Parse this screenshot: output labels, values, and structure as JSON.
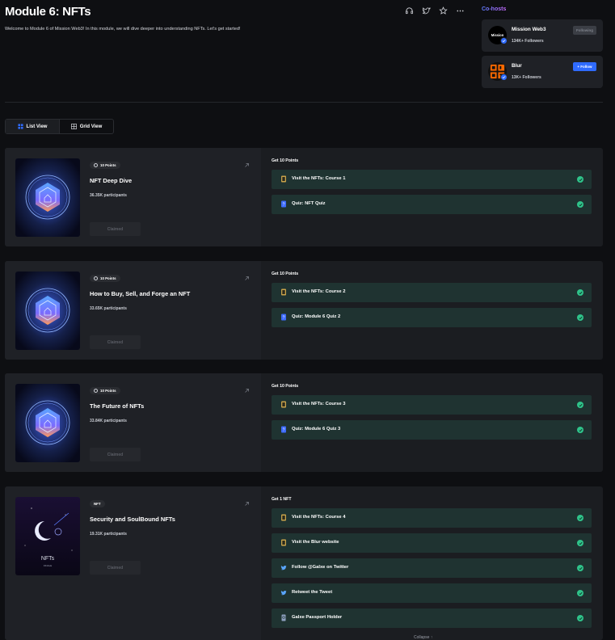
{
  "page": {
    "title": "Module 6: NFTs",
    "description": "Welcome to Module 6 of Mission Web3! In this module, we will dive deeper into understanding NFTs. Let's get started!"
  },
  "header_icons": [
    "headset-icon",
    "twitter-icon",
    "star-icon",
    "more-icon"
  ],
  "cohosts": {
    "title": "Co-hosts",
    "hosts": [
      {
        "name": "Mission Web3",
        "followers": "134K+ Followers",
        "button": "Following",
        "logo_text": "Mission"
      },
      {
        "name": "Blur",
        "followers": "13K+ Followers",
        "button": "+ Follow",
        "logo_text": "BLUR"
      }
    ]
  },
  "view_toggle": {
    "list": "List View",
    "grid": "Grid View",
    "selected": "List View"
  },
  "cards": [
    {
      "pill": "10 Points",
      "title": "NFT Deep Dive",
      "participants": "36.35K participants",
      "claim": "Claimed",
      "reward_header": "Get 10 Points",
      "tasks": [
        {
          "label": "Visit the NFTs: Course 1",
          "icon": "course-icon"
        },
        {
          "label": "Quiz: NFT Quiz",
          "icon": "quiz-icon"
        }
      ]
    },
    {
      "pill": "10 Points",
      "title": "How to Buy, Sell, and Forge an NFT",
      "participants": "33.65K participants",
      "claim": "Claimed",
      "reward_header": "Get 10 Points",
      "tasks": [
        {
          "label": "Visit the NFTs: Course 2",
          "icon": "course-icon"
        },
        {
          "label": "Quiz: Module 6 Quiz 2",
          "icon": "quiz-icon"
        }
      ]
    },
    {
      "pill": "10 Points",
      "title": "The Future of NFTs",
      "participants": "33.84K participants",
      "claim": "Claimed",
      "reward_header": "Get 10 Points",
      "tasks": [
        {
          "label": "Visit the NFTs: Course 3",
          "icon": "course-icon"
        },
        {
          "label": "Quiz: Module 6 Quiz 3",
          "icon": "quiz-icon"
        }
      ]
    },
    {
      "pill": "NFT",
      "title": "Security and SoulBound NFTs",
      "participants": "19.31K participants",
      "claim": "Claimed",
      "reward_header": "Get 1 NFT",
      "thumb_text": "NFTs",
      "thumb_sub": "FINALE",
      "tasks": [
        {
          "label": "Visit the NFTs: Course 4",
          "icon": "course-icon"
        },
        {
          "label": "Visit the Blur website",
          "icon": "course-icon"
        },
        {
          "label": "Follow @Galxe on Twitter",
          "icon": "twitter-follow-icon"
        },
        {
          "label": "Retweet the Tweet",
          "icon": "retweet-icon"
        },
        {
          "label": "Galxe Passport Holder",
          "icon": "passport-icon"
        }
      ]
    }
  ],
  "collapse_label": "Collapse"
}
